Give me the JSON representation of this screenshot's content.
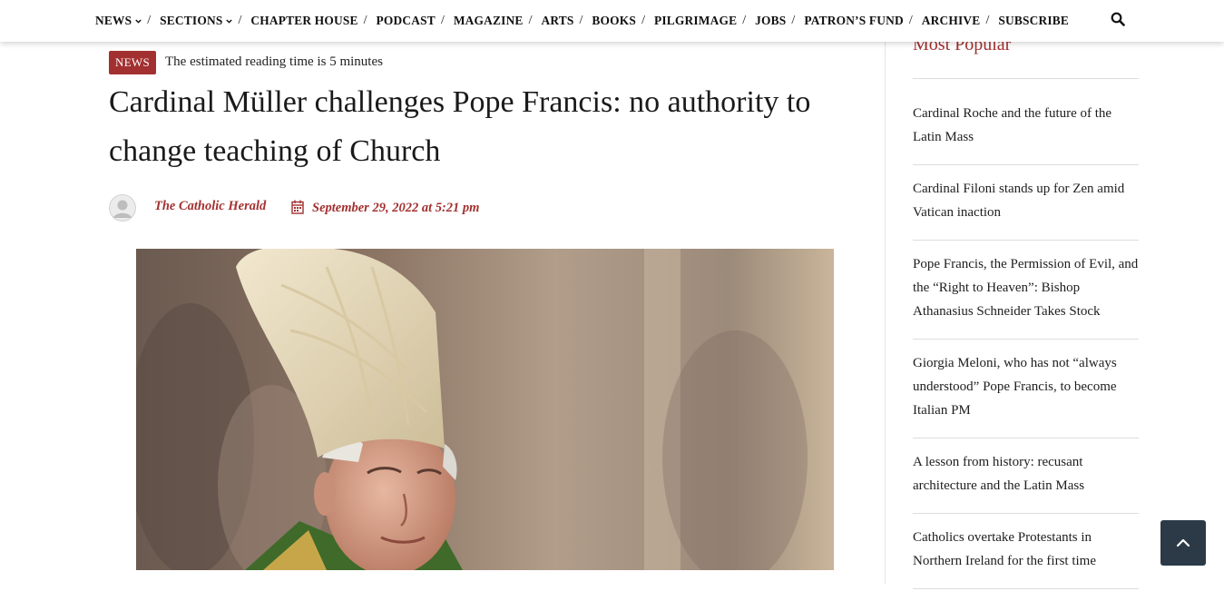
{
  "nav": {
    "items": [
      {
        "label": "NEWS",
        "has_caret": true
      },
      {
        "label": "SECTIONS",
        "has_caret": true
      },
      {
        "label": "CHAPTER HOUSE",
        "has_caret": false
      },
      {
        "label": "PODCAST",
        "has_caret": false
      },
      {
        "label": "MAGAZINE",
        "has_caret": false
      },
      {
        "label": "ARTS",
        "has_caret": false
      },
      {
        "label": "BOOKS",
        "has_caret": false
      },
      {
        "label": "PILGRIMAGE",
        "has_caret": false
      },
      {
        "label": "JOBS",
        "has_caret": false
      },
      {
        "label": "PATRON’S FUND",
        "has_caret": false
      },
      {
        "label": "ARCHIVE",
        "has_caret": false
      },
      {
        "label": "SUBSCRIBE",
        "has_caret": false
      }
    ],
    "separator": "/",
    "search_icon": "search-icon"
  },
  "article": {
    "category": "NEWS",
    "reading_time": "The estimated reading time is 5 minutes",
    "title": "Cardinal Müller challenges Pope Francis: no authority to change teaching of Church",
    "author": "The Catholic Herald",
    "date": "September 29, 2022 at 5:21 pm"
  },
  "sidebar": {
    "heading": "Most Popular",
    "items": [
      "Cardinal Roche and the future of the Latin Mass",
      "Cardinal Filoni stands up for Zen amid Vatican inaction",
      "Pope Francis, the Permission of Evil, and the “Right to Heaven”: Bishop Athanasius Schneider Takes Stock",
      "Giorgia Meloni, who has not “always understood” Pope Francis, to become Italian PM",
      "A lesson from history: recusant architecture and the Latin Mass",
      "Catholics overtake Protestants in Northern Ireland for the first time"
    ]
  },
  "colors": {
    "accent": "#a33030",
    "back_to_top": "#2c3a47"
  }
}
